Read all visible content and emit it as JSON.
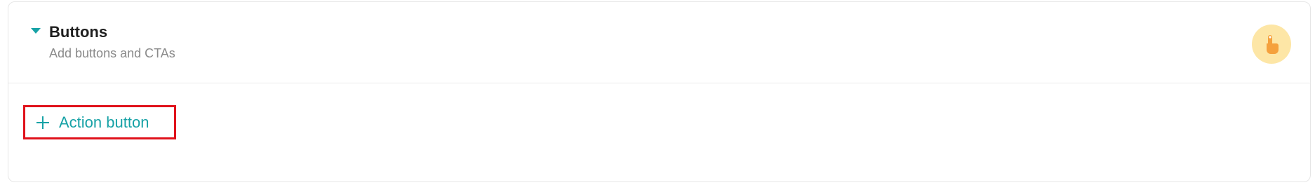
{
  "section": {
    "title": "Buttons",
    "subtitle": "Add buttons and CTAs",
    "icon": "hand-pointer-icon",
    "toggle_icon": "caret-down-icon"
  },
  "actions": {
    "add_button_label": "Action button",
    "add_icon": "plus-icon"
  },
  "colors": {
    "accent": "#17a2a6",
    "badge_bg": "#fde6a6",
    "badge_icon": "#f5a13d",
    "highlight_border": "#e0121b"
  }
}
